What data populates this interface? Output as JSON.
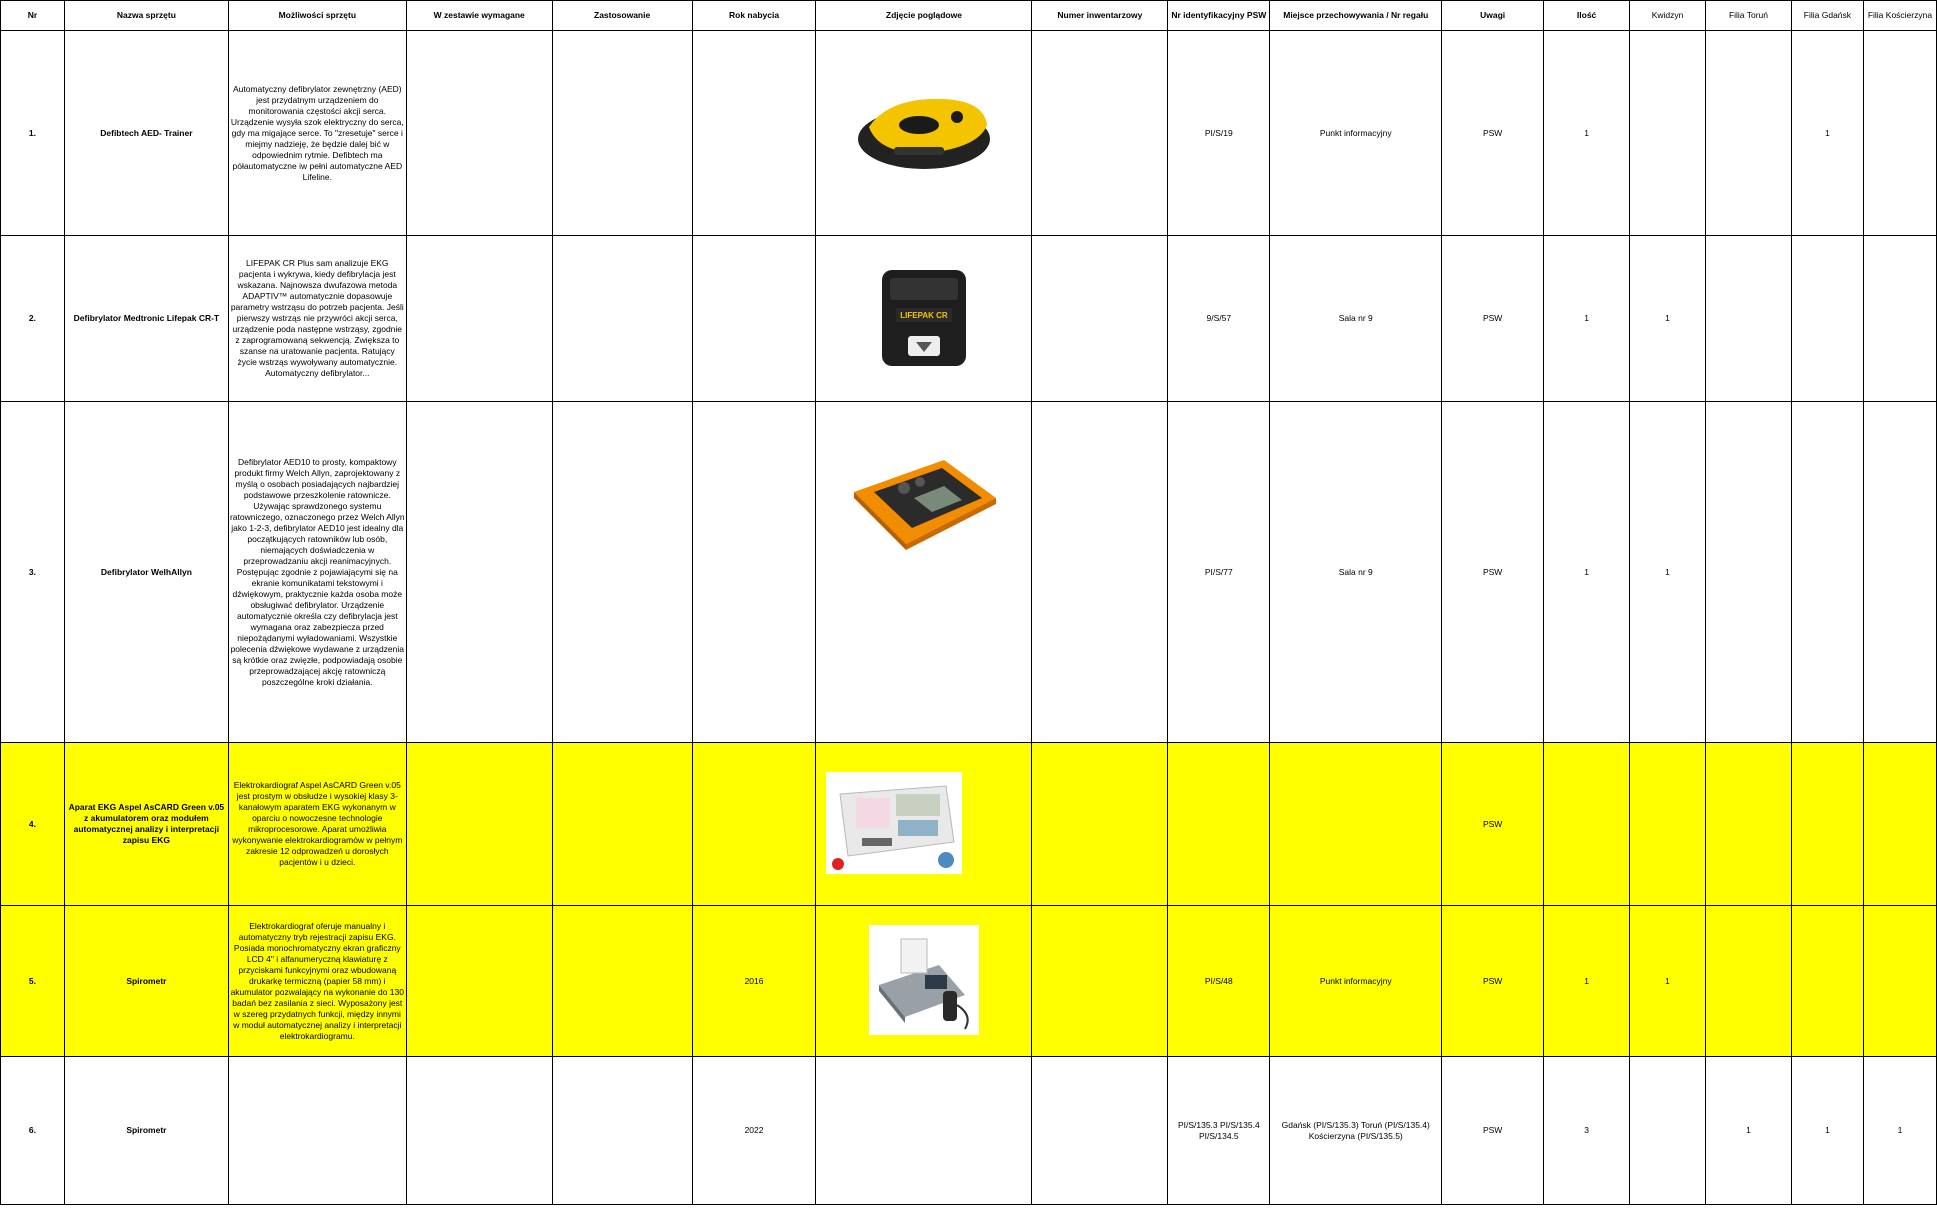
{
  "headers": {
    "nr": "Nr",
    "name": "Nazwa sprzętu",
    "capabilities": "Możliwości sprzętu",
    "required_set": "W zestawie wymagane",
    "usage": "Zastosowanie",
    "year": "Rok nabycia",
    "photo": "Zdjęcie poglądowe",
    "inventory_number": "Numer inwentarzowy",
    "psw_id": "Nr identyfikacyjny PSW",
    "storage": "Miejsce przechowywania / Nr regału",
    "notes": "Uwagi",
    "qty": "Ilość",
    "kwidzyn": "Kwidzyn",
    "torun": "Filia Toruń",
    "gdansk": "Filia Gdańsk",
    "koscierzyna": "Filia Kościerzyna"
  },
  "rows": [
    {
      "nr": "1.",
      "name": "Defibtech AED- Trainer",
      "capabilities": "Automatyczny defibrylator zewnętrzny (AED) jest przydatnym urządzeniem do monitorowania częstości akcji serca. Urządzenie wysyła szok elektryczny do serca, gdy ma migające serce. To \"zresetuje\" serce i miejmy nadzieję, że będzie dalej bić w odpowiednim rytmie. Defibtech ma półautomatyczne iw pełni automatyczne AED Lifeline.",
      "required_set": "",
      "usage": "",
      "year": "",
      "photo_icon": "aed-trainer-photo",
      "inventory_number": "",
      "psw_id": "PI/S/19",
      "storage": "Punkt informacyjny",
      "notes": "PSW",
      "qty": "1",
      "kwidzyn": "",
      "torun": "",
      "gdansk": "1",
      "koscierzyna": ""
    },
    {
      "nr": "2.",
      "name": "Defibrylator Medtronic Lifepak CR-T",
      "capabilities": "LIFEPAK CR Plus sam analizuje EKG pacjenta i wykrywa, kiedy defibrylacja jest wskazana. Najnowsza dwufazowa metoda ADAPTIV™ automatycznie dopasowuje parametry wstrząsu do potrzeb pacjenta. Jeśli pierwszy wstrząs nie przywróci akcji serca, urządzenie poda następne wstrząsy, zgodnie z zaprogramowaną sekwencją. Zwiększa to szanse na uratowanie pacjenta. Ratujący życie wstrząs wywoływany automatycznie. Automatyczny defibrylator...",
      "required_set": "",
      "usage": "",
      "year": "",
      "photo_icon": "lifepak-photo",
      "photo_label": "LIFEPAK CR",
      "inventory_number": "",
      "psw_id": "9/S/57",
      "storage": "Sala nr 9",
      "notes": "PSW",
      "qty": "1",
      "kwidzyn": "1",
      "torun": "",
      "gdansk": "",
      "koscierzyna": ""
    },
    {
      "nr": "3.",
      "name": "Defibrylator WelhAllyn",
      "capabilities": "Defibrylator AED10 to prosty, kompaktowy produkt firmy Welch Allyn, zaprojektowany z myślą o osobach posiadających najbardziej podstawowe przeszkolenie ratownicze. Używając sprawdzonego systemu ratowniczego, oznaczonego przez Welch Allyn jako 1-2-3, defibrylator AED10 jest idealny dla początkujących ratowników lub osób, niemających doświadczenia w przeprowadzaniu akcji reanimacyjnych. Postępując zgodnie z pojawiającymi się na ekranie komunikatami tekstowymi i dźwiękowym, praktycznie każda osoba może obsługiwać defibrylator. Urządzenie automatycznie określa czy defibrylacja jest wymagana oraz zabezpiecza przed niepożądanymi wyładowaniami. Wszystkie polecenia dźwiękowe wydawane z urządzenia są krótkie oraz zwięzłe, podpowiadają osobie przeprowadzającej akcję ratowniczą poszczególne kroki działania.",
      "required_set": "",
      "usage": "",
      "year": "",
      "photo_icon": "welch-allyn-aed10-photo",
      "inventory_number": "",
      "psw_id": "PI/S/77",
      "storage": "Sala nr 9",
      "notes": "PSW",
      "qty": "1",
      "kwidzyn": "1",
      "torun": "",
      "gdansk": "",
      "koscierzyna": ""
    },
    {
      "nr": "4.",
      "name": "Aparat EKG Aspel AsCARD Green v.05 z akumulatorem oraz modułem automatycznej analizy i interpretacji zapisu EKG",
      "capabilities": "Elektrokardiograf Aspel AsCARD Green v.05 jest prostym w obsłudze i wysokiej klasy 3-kanałowym aparatem EKG wykonanym w oparciu o nowoczesne technologie mikroprocesorowe. Aparat umożliwia wykonywanie elektrokardiogramów w pełnym zakresie 12 odprowadzeń u dorosłych pacjentów i u dzieci.",
      "required_set": "",
      "usage": "",
      "year": "",
      "photo_icon": "ekg-ascard-photo",
      "inventory_number": "",
      "psw_id": "",
      "storage": "",
      "notes": "PSW",
      "qty": "",
      "kwidzyn": "",
      "torun": "",
      "gdansk": "",
      "koscierzyna": ""
    },
    {
      "nr": "5.",
      "name": "Spirometr",
      "capabilities": "Elektrokardiograf oferuje manualny i automatyczny tryb rejestracji zapisu EKG. Posiada monochromatyczny ekran graficzny LCD 4\" i alfanumeryczną klawiaturę z przyciskami funkcyjnymi oraz wbudowaną drukarkę termiczną (papier 58 mm) i akumulator pozwalający na wykonanie do 130 badań bez zasilania z sieci. Wyposażony jest w szereg przydatnych funkcji, między innymi w moduł automatycznej analizy i interpretacji elektrokardiogramu.",
      "required_set": "",
      "usage": "",
      "year": "2016",
      "photo_icon": "spirometer-photo",
      "inventory_number": "",
      "psw_id": "PI/S/48",
      "storage": "Punkt informacyjny",
      "notes": "PSW",
      "qty": "1",
      "kwidzyn": "1",
      "torun": "",
      "gdansk": "",
      "koscierzyna": ""
    },
    {
      "nr": "6.",
      "name": "Spirometr",
      "capabilities": "",
      "required_set": "",
      "usage": "",
      "year": "2022",
      "photo_icon": "",
      "inventory_number": "",
      "psw_id": "PI/S/135.3\nPI/S/135.4\nPI/S/134.5",
      "storage": "Gdańsk (PI/S/135.3)\nToruń (PI/S/135.4)\nKościerzyna (PI/S/135.5)",
      "notes": "PSW",
      "qty": "3",
      "kwidzyn": "",
      "torun": "1",
      "gdansk": "1",
      "koscierzyna": "1"
    }
  ],
  "colors": {
    "highlight": "#ffff00",
    "grid": "#000000",
    "aed_yellow": "#f5c400",
    "aed_dark": "#222222",
    "welch_orange": "#f28c00"
  }
}
